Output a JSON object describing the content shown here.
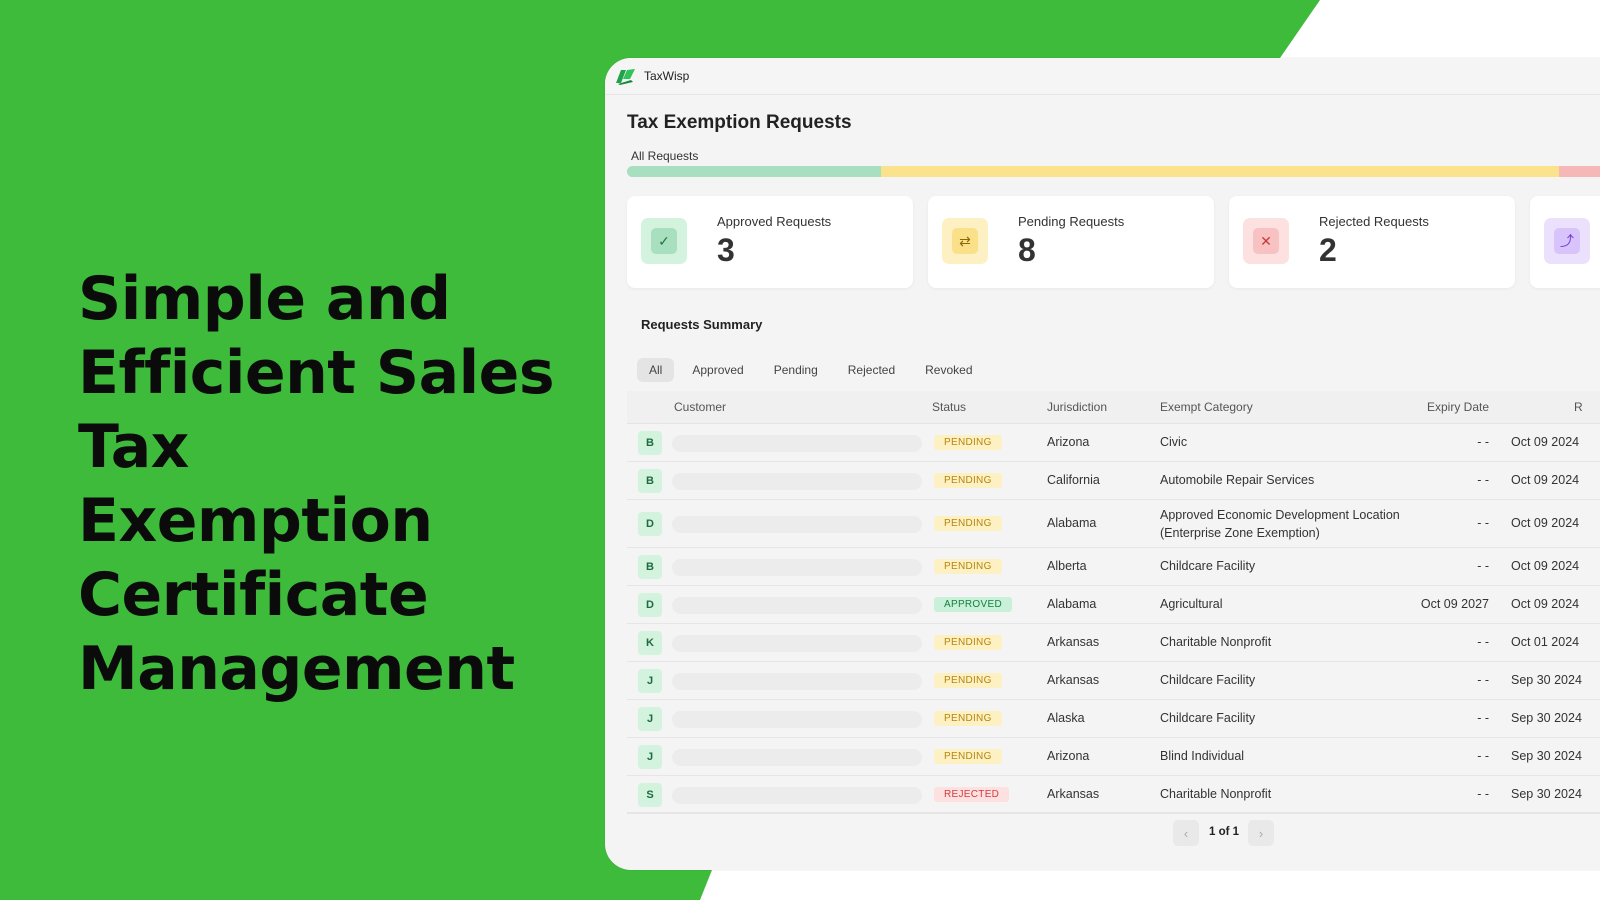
{
  "headline": "Simple and Efficient Sales Tax Exemption Certificate Management",
  "app": {
    "name": "TaxWisp",
    "logo_icon": "leaf-logo-icon"
  },
  "page": {
    "title": "Tax Exemption Requests",
    "subtitle": "All Requests"
  },
  "distribution": {
    "approved_fraction": 0.254,
    "pending_fraction": 0.678,
    "rejected_fraction": 0.068,
    "colors": {
      "approved": "#a7dfc0",
      "pending": "#fbe38e",
      "rejected": "#f6b7b7"
    }
  },
  "cards": [
    {
      "label": "Approved Requests",
      "value": "3",
      "icon": "check-icon",
      "bg": "#d3f3df",
      "inner": "#a8e0bf",
      "fg": "#1d7a44"
    },
    {
      "label": "Pending Requests",
      "value": "8",
      "icon": "refresh-icon",
      "bg": "#fdf1c4",
      "inner": "#fbe08a",
      "fg": "#8a6a05"
    },
    {
      "label": "Rejected Requests",
      "value": "2",
      "icon": "close-icon",
      "bg": "#fde0e0",
      "inner": "#f9c2c2",
      "fg": "#c43b3b"
    },
    {
      "label": "",
      "value": "",
      "icon": "share-icon",
      "bg": "#ebe1fd",
      "inner": "#d8c3fb",
      "fg": "#6b3ed6"
    }
  ],
  "summary": {
    "title": "Requests Summary",
    "tabs": [
      "All",
      "Approved",
      "Pending",
      "Rejected",
      "Revoked"
    ],
    "active_tab": "All",
    "columns": [
      "Customer",
      "Status",
      "Jurisdiction",
      "Exempt Category",
      "Expiry Date",
      "R"
    ],
    "rows": [
      {
        "initial": "B",
        "status": "PENDING",
        "status_type": "pending",
        "jurisdiction": "Arizona",
        "category": "Civic",
        "expiry": "- -",
        "date": "Oct 09 2024"
      },
      {
        "initial": "B",
        "status": "PENDING",
        "status_type": "pending",
        "jurisdiction": "California",
        "category": "Automobile Repair Services",
        "expiry": "- -",
        "date": "Oct 09 2024"
      },
      {
        "initial": "D",
        "status": "PENDING",
        "status_type": "pending",
        "jurisdiction": "Alabama",
        "category": "Approved Economic Development Location (Enterprise Zone Exemption)",
        "expiry": "- -",
        "date": "Oct 09 2024"
      },
      {
        "initial": "B",
        "status": "PENDING",
        "status_type": "pending",
        "jurisdiction": "Alberta",
        "category": "Childcare Facility",
        "expiry": "- -",
        "date": "Oct 09 2024"
      },
      {
        "initial": "D",
        "status": "APPROVED",
        "status_type": "approved",
        "jurisdiction": "Alabama",
        "category": "Agricultural",
        "expiry": "Oct 09 2027",
        "date": "Oct 09 2024"
      },
      {
        "initial": "K",
        "status": "PENDING",
        "status_type": "pending",
        "jurisdiction": "Arkansas",
        "category": "Charitable Nonprofit",
        "expiry": "- -",
        "date": "Oct 01 2024"
      },
      {
        "initial": "J",
        "status": "PENDING",
        "status_type": "pending",
        "jurisdiction": "Arkansas",
        "category": "Childcare Facility",
        "expiry": "- -",
        "date": "Sep 30 2024"
      },
      {
        "initial": "J",
        "status": "PENDING",
        "status_type": "pending",
        "jurisdiction": "Alaska",
        "category": "Childcare Facility",
        "expiry": "- -",
        "date": "Sep 30 2024"
      },
      {
        "initial": "J",
        "status": "PENDING",
        "status_type": "pending",
        "jurisdiction": "Arizona",
        "category": "Blind Individual",
        "expiry": "- -",
        "date": "Sep 30 2024"
      },
      {
        "initial": "S",
        "status": "REJECTED",
        "status_type": "rejected",
        "jurisdiction": "Arkansas",
        "category": "Charitable Nonprofit",
        "expiry": "- -",
        "date": "Sep 30 2024"
      }
    ]
  },
  "pagination": {
    "text": "1 of 1",
    "prev_icon": "chevron-left-icon",
    "next_icon": "chevron-right-icon"
  }
}
